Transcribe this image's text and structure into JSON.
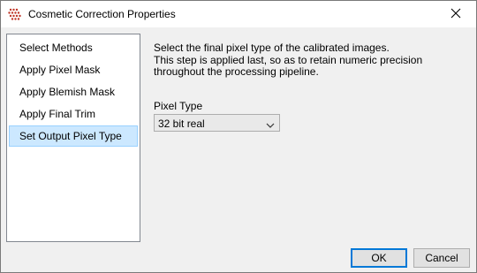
{
  "window": {
    "title": "Cosmetic Correction Properties",
    "app_icon": "cluster-grid-icon",
    "close_icon": "close-icon",
    "accent_color": "#0078d7"
  },
  "nav": {
    "items": [
      {
        "label": "Select Methods",
        "selected": false
      },
      {
        "label": "Apply Pixel Mask",
        "selected": false
      },
      {
        "label": "Apply Blemish Mask",
        "selected": false
      },
      {
        "label": "Apply Final Trim",
        "selected": false
      },
      {
        "label": "Set Output Pixel Type",
        "selected": true
      }
    ]
  },
  "main": {
    "description_line1": "Select the final pixel type of the calibrated images.",
    "description_line2": "This step is applied last, so as to retain numeric precision throughout the processing pipeline.",
    "pixel_type_label": "Pixel Type",
    "pixel_type_value": "32 bit real"
  },
  "buttons": {
    "ok_label": "OK",
    "cancel_label": "Cancel"
  }
}
